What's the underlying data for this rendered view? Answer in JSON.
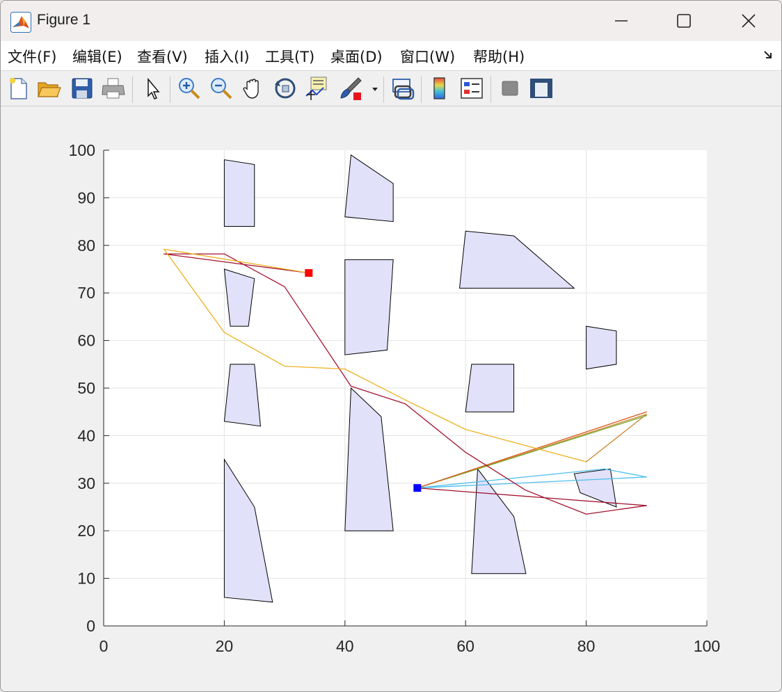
{
  "window": {
    "title": "Figure 1"
  },
  "menu": [
    {
      "label": "文件(F)",
      "name": "menu-file"
    },
    {
      "label": "编辑(E)",
      "name": "menu-edit"
    },
    {
      "label": "查看(V)",
      "name": "menu-view"
    },
    {
      "label": "插入(I)",
      "name": "menu-insert"
    },
    {
      "label": "工具(T)",
      "name": "menu-tools"
    },
    {
      "label": "桌面(D)",
      "name": "menu-desktop"
    },
    {
      "label": "窗口(W)",
      "name": "menu-window"
    },
    {
      "label": "帮助(H)",
      "name": "menu-help"
    }
  ],
  "toolbar": [
    "new-figure-icon",
    "open-folder-icon",
    "save-icon",
    "print-icon",
    "select-arrow-icon",
    "zoom-in-icon",
    "zoom-out-icon",
    "pan-hand-icon",
    "rotate-3d-icon",
    "data-cursor-icon",
    "brush-icon",
    "brush-dropdown-icon",
    "link-plot-icon",
    "colorbar-icon",
    "legend-icon",
    "hide-plot-tools-icon",
    "show-plot-tools-icon"
  ],
  "chart_data": {
    "type": "line",
    "title": "",
    "xlabel": "",
    "ylabel": "",
    "xlim": [
      0,
      100
    ],
    "ylim": [
      0,
      100
    ],
    "xticks": [
      0,
      20,
      40,
      60,
      80,
      100
    ],
    "yticks": [
      0,
      10,
      20,
      30,
      40,
      50,
      60,
      70,
      80,
      90,
      100
    ],
    "grid": true,
    "obstacles": [
      [
        [
          20,
          84
        ],
        [
          20,
          98
        ],
        [
          25,
          97
        ],
        [
          25,
          84
        ]
      ],
      [
        [
          40,
          86
        ],
        [
          41,
          99
        ],
        [
          48,
          93
        ],
        [
          48,
          85
        ]
      ],
      [
        [
          59,
          71
        ],
        [
          60,
          83
        ],
        [
          68,
          82
        ],
        [
          78,
          71
        ]
      ],
      [
        [
          20,
          75
        ],
        [
          25,
          73
        ],
        [
          24,
          63
        ],
        [
          21,
          63
        ]
      ],
      [
        [
          40,
          57
        ],
        [
          40,
          77
        ],
        [
          48,
          77
        ],
        [
          47,
          58
        ]
      ],
      [
        [
          80,
          54
        ],
        [
          80,
          63
        ],
        [
          85,
          62
        ],
        [
          85,
          55
        ]
      ],
      [
        [
          20,
          43
        ],
        [
          21,
          55
        ],
        [
          25,
          55
        ],
        [
          26,
          42
        ]
      ],
      [
        [
          60,
          45
        ],
        [
          61,
          55
        ],
        [
          68,
          55
        ],
        [
          68,
          45
        ]
      ],
      [
        [
          40,
          20
        ],
        [
          41,
          50
        ],
        [
          46,
          44
        ],
        [
          48,
          20
        ]
      ],
      [
        [
          20,
          6
        ],
        [
          20,
          35
        ],
        [
          25,
          25
        ],
        [
          28,
          5
        ]
      ],
      [
        [
          61,
          11
        ],
        [
          62,
          33
        ],
        [
          68,
          23
        ],
        [
          70,
          11
        ]
      ],
      [
        [
          78,
          32
        ],
        [
          79,
          28
        ],
        [
          85,
          25
        ],
        [
          84,
          33
        ]
      ]
    ],
    "obstacle_fill": "#e1e1f9",
    "series": [
      {
        "color": "#c9852d",
        "x": [
          52,
          90,
          80,
          90,
          52
        ],
        "y": [
          29,
          44.5,
          34.5,
          44.5,
          29
        ]
      },
      {
        "color": "#77ac30",
        "x": [
          52,
          90,
          52
        ],
        "y": [
          29,
          44.2,
          29
        ]
      },
      {
        "color": "#d95319",
        "x": [
          52,
          90,
          52
        ],
        "y": [
          29,
          45,
          29
        ]
      },
      {
        "color": "#4dbeee",
        "x": [
          52,
          90,
          83,
          52
        ],
        "y": [
          29,
          31.3,
          33,
          29
        ]
      },
      {
        "color": "#a2142f",
        "x": [
          52,
          90,
          80,
          70,
          60,
          50,
          41,
          30,
          20,
          10,
          34
        ],
        "y": [
          29,
          25.3,
          23.5,
          28.5,
          36.5,
          46.7,
          50.4,
          71.3,
          78.2,
          78.2,
          74.2
        ]
      },
      {
        "color": "#edb120",
        "x": [
          80,
          60,
          50,
          40,
          30,
          20,
          10,
          34
        ],
        "y": [
          34.5,
          41.3,
          47.5,
          54,
          54.6,
          61.7,
          79.2,
          74.2
        ]
      }
    ],
    "start": {
      "x": 52,
      "y": 29,
      "color": "#0000ff"
    },
    "goal": {
      "x": 34,
      "y": 74.2,
      "color": "#ff0000"
    }
  }
}
